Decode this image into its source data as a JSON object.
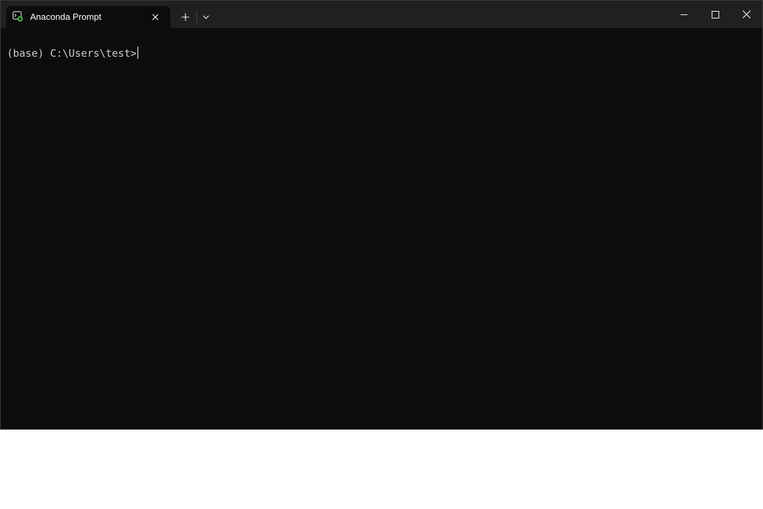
{
  "window": {
    "tab_title": "Anaconda Prompt"
  },
  "icons": {
    "tab_icon": "anaconda-prompt-icon",
    "tab_close": "close-icon",
    "new_tab": "plus-icon",
    "dropdown": "chevron-down-icon",
    "minimize": "minimize-icon",
    "maximize": "maximize-icon",
    "close": "close-icon"
  },
  "terminal": {
    "prompt": "(base) C:\\Users\\test>"
  },
  "colors": {
    "titlebar": "#202020",
    "terminal_bg": "#0c0c0c",
    "text": "#cccccc",
    "icon_accent": "#3fb04a"
  }
}
